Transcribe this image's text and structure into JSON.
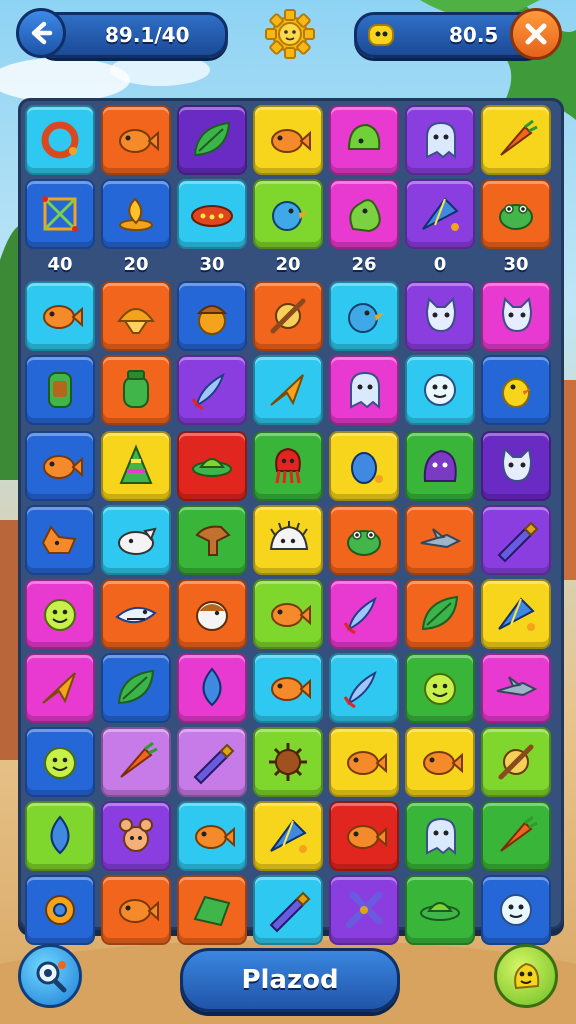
{
  "header": {
    "left_value": "89.1/40",
    "right_value": "80.5"
  },
  "bottom": {
    "button_label": "Plazod"
  },
  "scores": [
    "40",
    "20",
    "30",
    "20",
    "26",
    "0",
    "30"
  ],
  "palette": {
    "cyan": "#2fc8f0",
    "orange": "#f2651c",
    "purple": "#6a2bc4",
    "yellow": "#f7d51c",
    "magenta": "#e83ad0",
    "lime": "#7fd62c",
    "blue": "#2567d6",
    "green": "#39b53a",
    "red": "#e0261e",
    "lightpurple": "#c77be8",
    "violet": "#8a3ee0"
  },
  "grid": [
    [
      [
        "cyan",
        "ring"
      ],
      [
        "orange",
        "fish"
      ],
      [
        "purple",
        "leaf"
      ],
      [
        "yellow",
        "fish"
      ],
      [
        "magenta",
        "helmet"
      ],
      [
        "violet",
        "ghost"
      ],
      [
        "yellow",
        "carrot"
      ]
    ],
    [
      [
        "blue",
        "net"
      ],
      [
        "blue",
        "flame"
      ],
      [
        "cyan",
        "ufo"
      ],
      [
        "lime",
        "bird"
      ],
      [
        "magenta",
        "blob"
      ],
      [
        "violet",
        "kite"
      ],
      [
        "orange",
        "frog"
      ]
    ],
    [
      [
        "cyan",
        "fish"
      ],
      [
        "orange",
        "shell"
      ],
      [
        "blue",
        "acorn"
      ],
      [
        "orange",
        "spinner"
      ],
      [
        "cyan",
        "bird"
      ],
      [
        "violet",
        "cat"
      ],
      [
        "magenta",
        "cat"
      ]
    ],
    [
      [
        "blue",
        "phone"
      ],
      [
        "orange",
        "jar"
      ],
      [
        "violet",
        "rocket"
      ],
      [
        "cyan",
        "plane"
      ],
      [
        "magenta",
        "ghost"
      ],
      [
        "cyan",
        "face"
      ],
      [
        "blue",
        "duck"
      ]
    ],
    [
      [
        "blue",
        "fish"
      ],
      [
        "yellow",
        "cone"
      ],
      [
        "red",
        "saucer"
      ],
      [
        "green",
        "squid"
      ],
      [
        "yellow",
        "bug"
      ],
      [
        "green",
        "monster"
      ],
      [
        "purple",
        "cat"
      ]
    ],
    [
      [
        "blue",
        "fox"
      ],
      [
        "cyan",
        "dog"
      ],
      [
        "green",
        "horse"
      ],
      [
        "yellow",
        "hedgehog"
      ],
      [
        "orange",
        "frog"
      ],
      [
        "orange",
        "jet"
      ],
      [
        "violet",
        "pen"
      ]
    ],
    [
      [
        "magenta",
        "smile"
      ],
      [
        "orange",
        "shark"
      ],
      [
        "orange",
        "penguin"
      ],
      [
        "lime",
        "fish"
      ],
      [
        "magenta",
        "rocket"
      ],
      [
        "orange",
        "leaf"
      ],
      [
        "yellow",
        "kite"
      ]
    ],
    [
      [
        "magenta",
        "plane"
      ],
      [
        "blue",
        "leaf"
      ],
      [
        "magenta",
        "drop"
      ],
      [
        "cyan",
        "fish"
      ],
      [
        "cyan",
        "rocket"
      ],
      [
        "green",
        "smile"
      ],
      [
        "magenta",
        "jet"
      ]
    ],
    [
      [
        "blue",
        "smile"
      ],
      [
        "lightpurple",
        "carrot"
      ],
      [
        "lightpurple",
        "pen"
      ],
      [
        "lime",
        "urchin"
      ],
      [
        "yellow",
        "fish"
      ],
      [
        "yellow",
        "fish"
      ],
      [
        "lime",
        "spinner"
      ]
    ],
    [
      [
        "lime",
        "drop"
      ],
      [
        "violet",
        "mouse"
      ],
      [
        "cyan",
        "fish"
      ],
      [
        "yellow",
        "kite"
      ],
      [
        "red",
        "fish"
      ],
      [
        "green",
        "ghost"
      ],
      [
        "green",
        "carrot"
      ]
    ],
    [
      [
        "blue",
        "gear"
      ],
      [
        "orange",
        "fish"
      ],
      [
        "orange",
        "card"
      ],
      [
        "cyan",
        "pen"
      ],
      [
        "violet",
        "cross"
      ],
      [
        "green",
        "saucer"
      ],
      [
        "blue",
        "face"
      ]
    ]
  ]
}
